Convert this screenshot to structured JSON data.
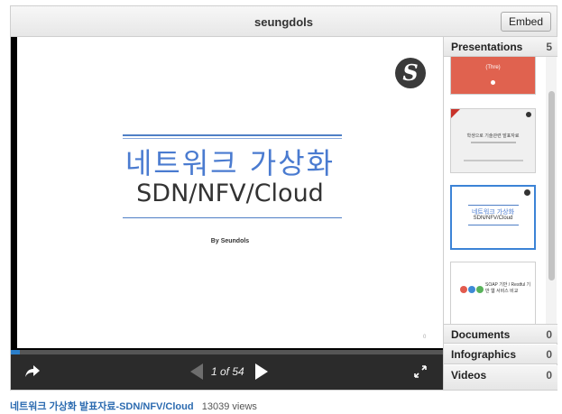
{
  "header": {
    "title": "seungdols",
    "embed_label": "Embed"
  },
  "slide": {
    "title_ko": "네트워크 가상화",
    "subtitle": "SDN/NFV/Cloud",
    "byline": "By Seundols",
    "corner_num": "0",
    "logo_letter": "S"
  },
  "player": {
    "page_text": "1 of 54",
    "progress": 0.02
  },
  "sidebar": {
    "presentations": {
      "label": "Presentations",
      "count": "5"
    },
    "documents": {
      "label": "Documents",
      "count": "0"
    },
    "infographics": {
      "label": "Infographics",
      "count": "0"
    },
    "videos": {
      "label": "Videos",
      "count": "0"
    },
    "thumbs": [
      {
        "text": "(Thre)"
      },
      {
        "text": "학생으로 기술관련 발표자료"
      },
      {
        "text": "네트워크 가상화",
        "sub": "SDN/NFV/Cloud"
      },
      {
        "text": "SOAP 기반 / Restful 기반 웹 서비스 비교"
      }
    ]
  },
  "caption": {
    "title": "네트워크 가상화 발표자료-SDN/NFV/Cloud",
    "views": "13039 views"
  },
  "colors": {
    "accent": "#2a7ec9",
    "title_blue": "#4a7bd0",
    "red_slide": "#e0624f"
  }
}
